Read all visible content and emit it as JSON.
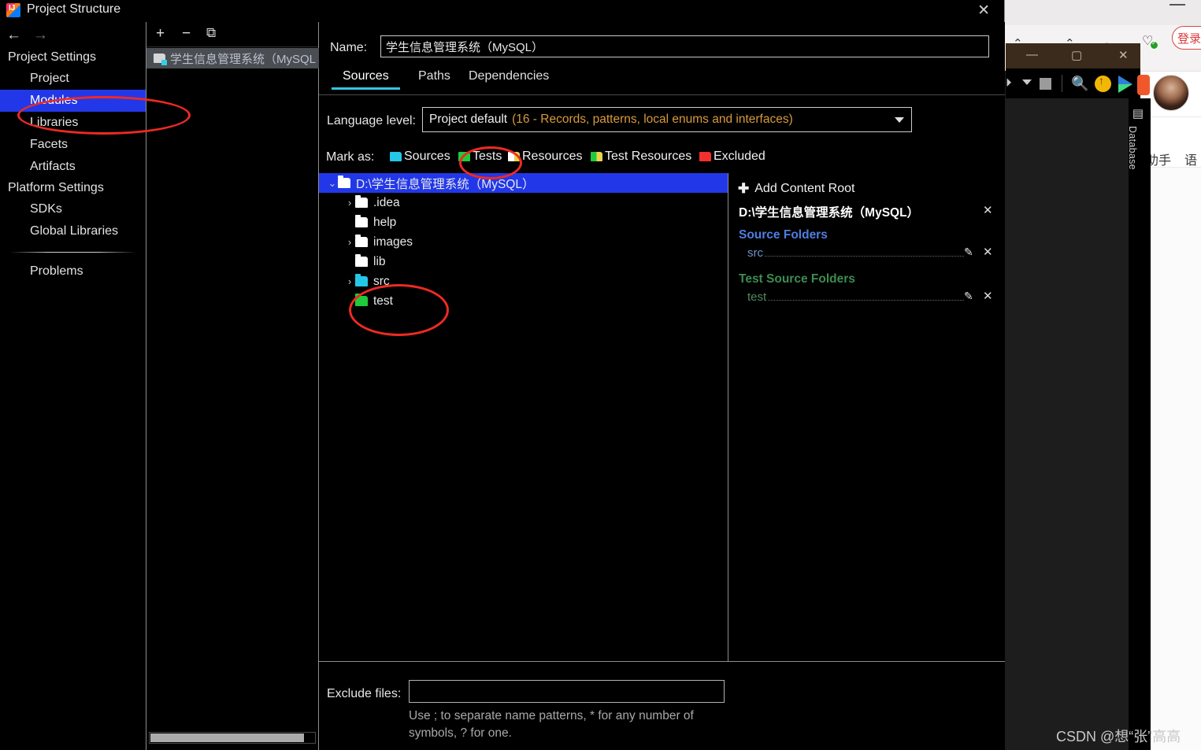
{
  "dialog": {
    "title": "Project Structure",
    "close_label": "✕",
    "icon": "intellij-idea-icon"
  },
  "nav": {
    "back_icon": "←",
    "forward_icon": "→",
    "groups": [
      {
        "label": "Project Settings",
        "items": [
          {
            "label": "Project",
            "selected": false
          },
          {
            "label": "Modules",
            "selected": true
          },
          {
            "label": "Libraries",
            "selected": false
          },
          {
            "label": "Facets",
            "selected": false
          },
          {
            "label": "Artifacts",
            "selected": false
          }
        ]
      },
      {
        "label": "Platform Settings",
        "items": [
          {
            "label": "SDKs",
            "selected": false
          },
          {
            "label": "Global Libraries",
            "selected": false
          }
        ]
      }
    ],
    "problems_label": "Problems"
  },
  "module_list": {
    "toolbar": {
      "add": "+",
      "remove": "−",
      "copy": "⧉"
    },
    "modules": [
      {
        "label": "学生信息管理系统（MySQL",
        "selected": true
      }
    ],
    "scrollbar": "horizontal-scrollbar"
  },
  "main": {
    "name_label": "Name:",
    "name_value": "学生信息管理系统（MySQL）",
    "tabs": [
      {
        "label": "Sources",
        "active": true
      },
      {
        "label": "Paths",
        "active": false
      },
      {
        "label": "Dependencies",
        "active": false
      }
    ],
    "language_level": {
      "label": "Language level:",
      "value_main": "Project default",
      "value_detail": "(16 - Records, patterns, local enums and interfaces)"
    },
    "mark_as": {
      "label": "Mark as:",
      "options": [
        {
          "label": "Sources",
          "color": "#25c7e8"
        },
        {
          "label": "Tests",
          "color": "#1ecb3b"
        },
        {
          "label": "Resources",
          "color": "#ffffff"
        },
        {
          "label": "Test Resources",
          "color": "#1ecb3b"
        },
        {
          "label": "Excluded",
          "color": "#f4302c"
        }
      ]
    },
    "tree": [
      {
        "label": "D:\\学生信息管理系统（MySQL）",
        "chev": "⌄",
        "folder": "white",
        "indent": 0,
        "selected": true
      },
      {
        "label": ".idea",
        "chev": "›",
        "folder": "white",
        "indent": 1,
        "selected": false
      },
      {
        "label": "help",
        "chev": "",
        "folder": "white",
        "indent": 1,
        "selected": false
      },
      {
        "label": "images",
        "chev": "›",
        "folder": "white",
        "indent": 1,
        "selected": false
      },
      {
        "label": "lib",
        "chev": "",
        "folder": "white",
        "indent": 1,
        "selected": false
      },
      {
        "label": "src",
        "chev": "›",
        "folder": "cyan",
        "indent": 1,
        "selected": false
      },
      {
        "label": "test",
        "chev": "",
        "folder": "green",
        "indent": 1,
        "selected": false
      }
    ],
    "details": {
      "add_content_root": "Add Content Root",
      "add_plus": "✚",
      "root_path": "D:\\学生信息管理系统（MySQL）",
      "root_remove": "✕",
      "source_folders_title": "Source Folders",
      "source_folders": [
        {
          "name": "src"
        }
      ],
      "test_source_folders_title": "Test Source Folders",
      "test_source_folders": [
        {
          "name": "test"
        }
      ],
      "edit_icon": "✎",
      "remove_icon": "✕"
    },
    "exclude": {
      "label": "Exclude files:",
      "value": "",
      "hint": "Use ; to separate name patterns, * for any number of symbols, ? for one."
    }
  },
  "background": {
    "login_button": "登录",
    "database_tool_label": "Database",
    "menu_items": [
      "助手",
      "语法"
    ],
    "ide_window_buttons": {
      "minimize": "—",
      "maximize": "▢",
      "close": "✕"
    }
  },
  "watermark": "CSDN @想“张”高高",
  "colors": {
    "accent_blue": "#2238e8",
    "tab_underline": "#34c6e0",
    "annotation_red": "#ee2a22",
    "source_blue": "#4e7fe0",
    "test_green": "#3d8c50",
    "lang_orange": "#d79a3d"
  }
}
